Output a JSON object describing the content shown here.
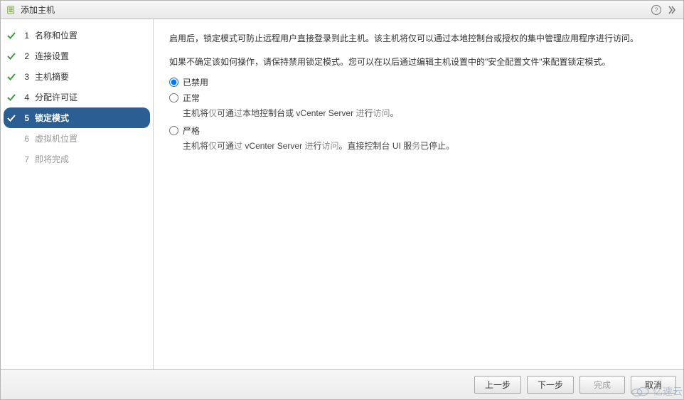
{
  "title": "添加主机",
  "steps": [
    {
      "num": "1",
      "label": "名称和位置",
      "state": "done"
    },
    {
      "num": "2",
      "label": "连接设置",
      "state": "done"
    },
    {
      "num": "3",
      "label": "主机摘要",
      "state": "done"
    },
    {
      "num": "4",
      "label": "分配许可证",
      "state": "done"
    },
    {
      "num": "5",
      "label": "锁定模式",
      "state": "current"
    },
    {
      "num": "6",
      "label": "虚拟机位置",
      "state": "pending"
    },
    {
      "num": "7",
      "label": "即将完成",
      "state": "pending"
    }
  ],
  "content": {
    "desc1": "启用后，锁定模式可防止远程用户直接登录到此主机。该主机将仅可以通过本地控制台或授权的集中管理应用程序进行访问。",
    "desc2": "如果不确定该如何操作，请保持禁用锁定模式。您可以在以后通过编辑主机设置中的\"安全配置文件\"来配置锁定模式。",
    "options": {
      "disabled": {
        "label": "已禁用"
      },
      "normal": {
        "label": "正常",
        "desc_pre": "主机将",
        "desc_gray1": "仅",
        "desc_mid1": "可通",
        "desc_gray2": "过",
        "desc_mid2": "本地控制台或 vCenter Server ",
        "desc_gray3": "进",
        "desc_mid3": "行",
        "desc_gray4": "访问",
        "desc_end": "。"
      },
      "strict": {
        "label": "严格",
        "desc_pre": "主机将",
        "desc_gray1": "仅",
        "desc_mid1": "可通",
        "desc_gray2": "过",
        "desc_mid2": " vCenter Server ",
        "desc_gray3": "进",
        "desc_mid3": "行",
        "desc_gray4": "访问",
        "desc_mid4": "。直接控制台 UI 服",
        "desc_gray5": "务",
        "desc_end": "已停止。"
      }
    },
    "selected": "disabled"
  },
  "buttons": {
    "back": "上一步",
    "next": "下一步",
    "finish": "完成",
    "cancel": "取消"
  },
  "watermark": "亿速云"
}
